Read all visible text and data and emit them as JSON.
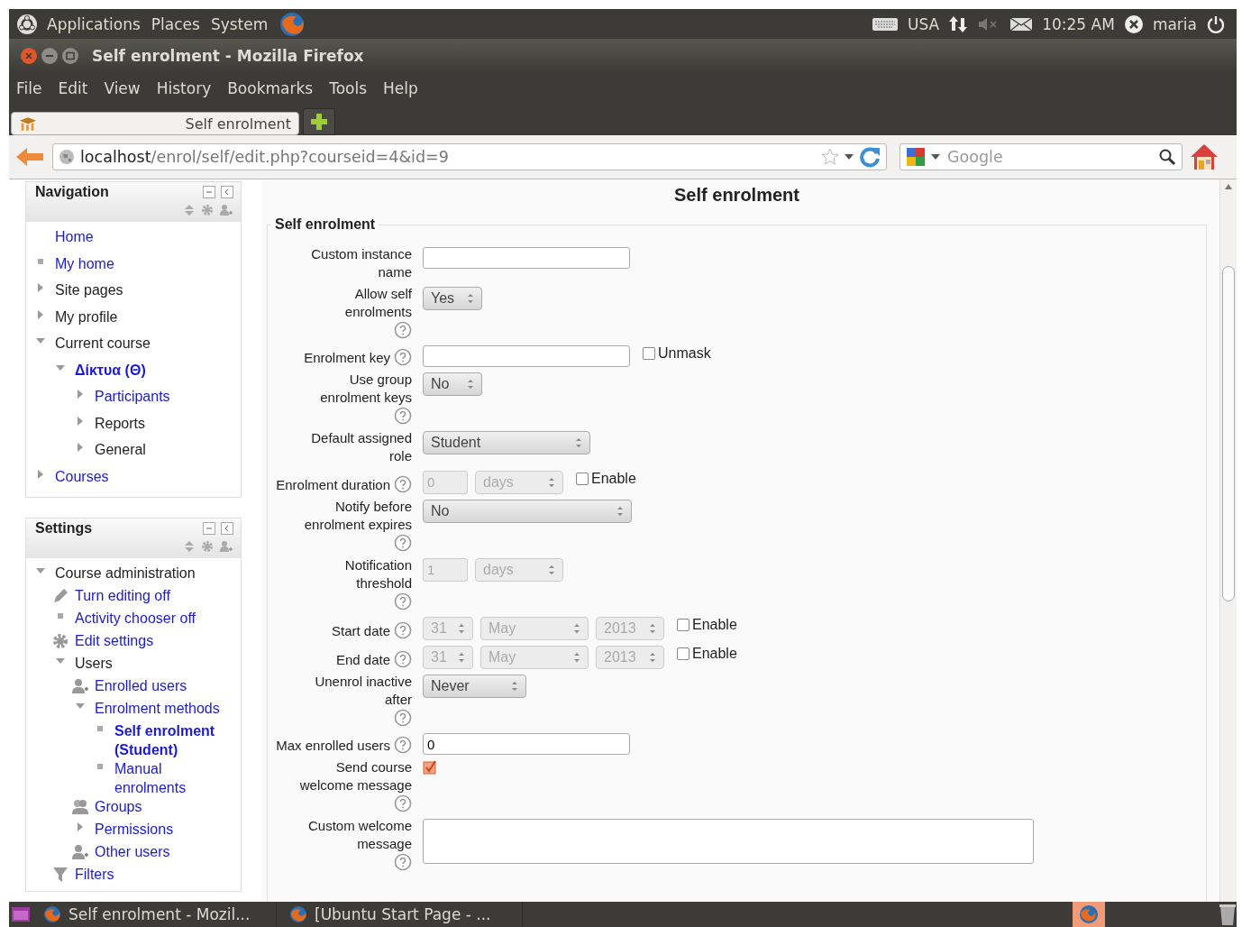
{
  "top_panel": {
    "menus": [
      "Applications",
      "Places",
      "System"
    ],
    "keyboard": "USA",
    "clock": "10:25 AM",
    "user": "maria"
  },
  "window": {
    "title": "Self enrolment - Mozilla Firefox"
  },
  "menubar": [
    "File",
    "Edit",
    "View",
    "History",
    "Bookmarks",
    "Tools",
    "Help"
  ],
  "tabs": [
    {
      "label": "Self enrolment",
      "selected": true
    }
  ],
  "address_bar": {
    "host": "localhost",
    "path": "/enrol/self/edit.php?courseid=4&id=9"
  },
  "search": {
    "placeholder": "Google"
  },
  "navigation": {
    "title": "Navigation",
    "items": [
      {
        "label": "Home",
        "kind": "plain",
        "link": true,
        "current": false
      },
      {
        "label": "My home",
        "kind": "bullet",
        "link": true,
        "current": false
      },
      {
        "label": "Site pages",
        "kind": "branch",
        "expanded": false,
        "link": false,
        "current": false
      },
      {
        "label": "My profile",
        "kind": "branch",
        "expanded": false,
        "link": false,
        "current": false
      },
      {
        "label": "Current course",
        "kind": "branch",
        "expanded": true,
        "link": false,
        "current": false,
        "children": [
          {
            "label": "Δίκτυα (Θ)",
            "kind": "branch",
            "expanded": true,
            "link": true,
            "current": true,
            "children": [
              {
                "label": "Participants",
                "kind": "branch",
                "expanded": false,
                "link": true,
                "current": false
              },
              {
                "label": "Reports",
                "kind": "branch",
                "expanded": false,
                "link": false,
                "current": false
              },
              {
                "label": "General",
                "kind": "branch",
                "expanded": false,
                "link": false,
                "current": false
              }
            ]
          }
        ]
      },
      {
        "label": "Courses",
        "kind": "branch",
        "expanded": false,
        "link": true,
        "current": false
      }
    ]
  },
  "settings": {
    "title": "Settings",
    "items": [
      {
        "label": "Course administration",
        "kind": "branch",
        "expanded": true,
        "link": false,
        "current": false,
        "children": [
          {
            "label": "Turn editing off",
            "kind": "pencil",
            "link": true,
            "current": false
          },
          {
            "label": "Activity chooser off",
            "kind": "bullet",
            "link": true,
            "current": false
          },
          {
            "label": "Edit settings",
            "kind": "gear",
            "link": true,
            "current": false
          },
          {
            "label": "Users",
            "kind": "branch",
            "expanded": true,
            "link": false,
            "current": false,
            "children": [
              {
                "label": "Enrolled users",
                "kind": "user",
                "link": true,
                "current": false
              },
              {
                "label": "Enrolment methods",
                "kind": "branch",
                "expanded": true,
                "link": true,
                "current": false,
                "children": [
                  {
                    "label": "Self enrolment (Student)",
                    "kind": "bullet",
                    "link": true,
                    "current": true
                  },
                  {
                    "label": "Manual enrolments",
                    "kind": "bullet",
                    "link": true,
                    "current": false
                  }
                ]
              },
              {
                "label": "Groups",
                "kind": "group",
                "link": true,
                "current": false
              },
              {
                "label": "Permissions",
                "kind": "branch",
                "expanded": false,
                "link": true,
                "current": false
              },
              {
                "label": "Other users",
                "kind": "user",
                "link": true,
                "current": false
              }
            ]
          },
          {
            "label": "Filters",
            "kind": "filter",
            "link": true,
            "current": false
          }
        ]
      }
    ]
  },
  "page": {
    "title": "Self enrolment",
    "legend": "Self enrolment",
    "fields": [
      {
        "kind": "text",
        "label": "Custom instance name",
        "help": false
      },
      {
        "kind": "select",
        "label": "Allow self enrolments",
        "help": true,
        "value": "Yes"
      },
      {
        "kind": "text",
        "label": "Enrolment key",
        "help": true,
        "option": {
          "label": "Unmask",
          "checked": false
        }
      },
      {
        "kind": "select",
        "label": "Use group enrolment keys",
        "help": true,
        "value": "No"
      },
      {
        "kind": "select",
        "label": "Default assigned role",
        "help": false,
        "value": "Student"
      },
      {
        "kind": "duration",
        "label": "Enrolment duration",
        "help": true,
        "disabled": true,
        "value": "0",
        "unit": "days",
        "option": {
          "label": "Enable",
          "checked": false
        }
      },
      {
        "kind": "select",
        "label": "Notify before enrolment expires",
        "help": true,
        "value": "No"
      },
      {
        "kind": "duration",
        "label": "Notification threshold",
        "help": true,
        "disabled": true,
        "value": "1",
        "unit": "days"
      },
      {
        "kind": "date",
        "label": "Start date",
        "help": true,
        "disabled": true,
        "day": "31",
        "month": "May",
        "year": "2013",
        "option": {
          "label": "Enable",
          "checked": false
        }
      },
      {
        "kind": "date",
        "label": "End date",
        "help": true,
        "disabled": true,
        "day": "31",
        "month": "May",
        "year": "2013",
        "option": {
          "label": "Enable",
          "checked": false
        }
      },
      {
        "kind": "select",
        "label": "Unenrol inactive after",
        "help": true,
        "value": "Never"
      },
      {
        "kind": "text",
        "label": "Max enrolled users",
        "help": true,
        "value": "0"
      },
      {
        "kind": "checkbox",
        "label": "Send course welcome message",
        "help": true,
        "checked": true
      },
      {
        "kind": "textarea",
        "label": "Custom welcome message",
        "help": true
      }
    ]
  },
  "taskbar": [
    {
      "label": "Self enrolment - Mozil..."
    },
    {
      "label": "[Ubuntu Start Page - ..."
    }
  ]
}
